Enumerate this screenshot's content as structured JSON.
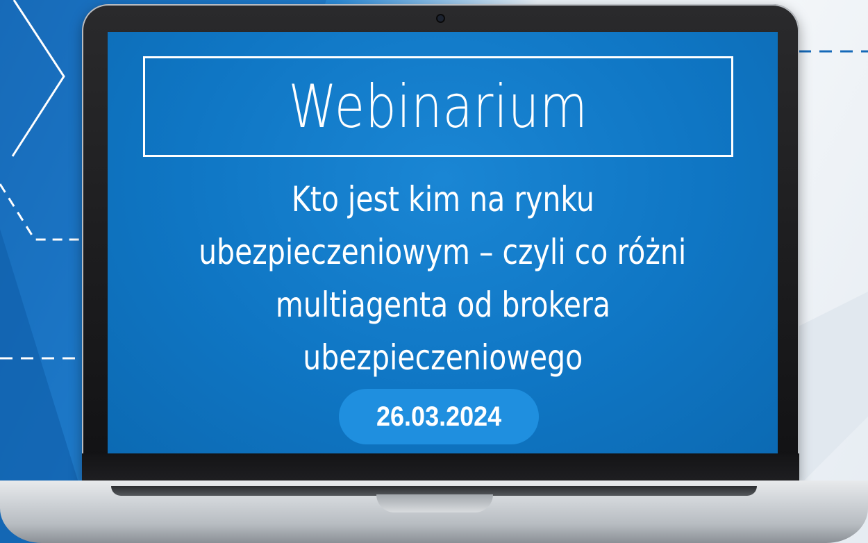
{
  "banner": {
    "title": "Webinarium",
    "subtitle_lines": [
      "Kto jest kim na rynku",
      "ubezpieczeniowym – czyli co różni",
      "multiagenta od brokera",
      "ubezpieczeniowego"
    ],
    "date": "26.03.2024"
  },
  "colors": {
    "screen_blue": "#0f76c4",
    "date_pill": "#1f8fdf",
    "text": "#ffffff"
  },
  "icons": {
    "camera": "webcam-icon",
    "laptop": "laptop-icon"
  }
}
